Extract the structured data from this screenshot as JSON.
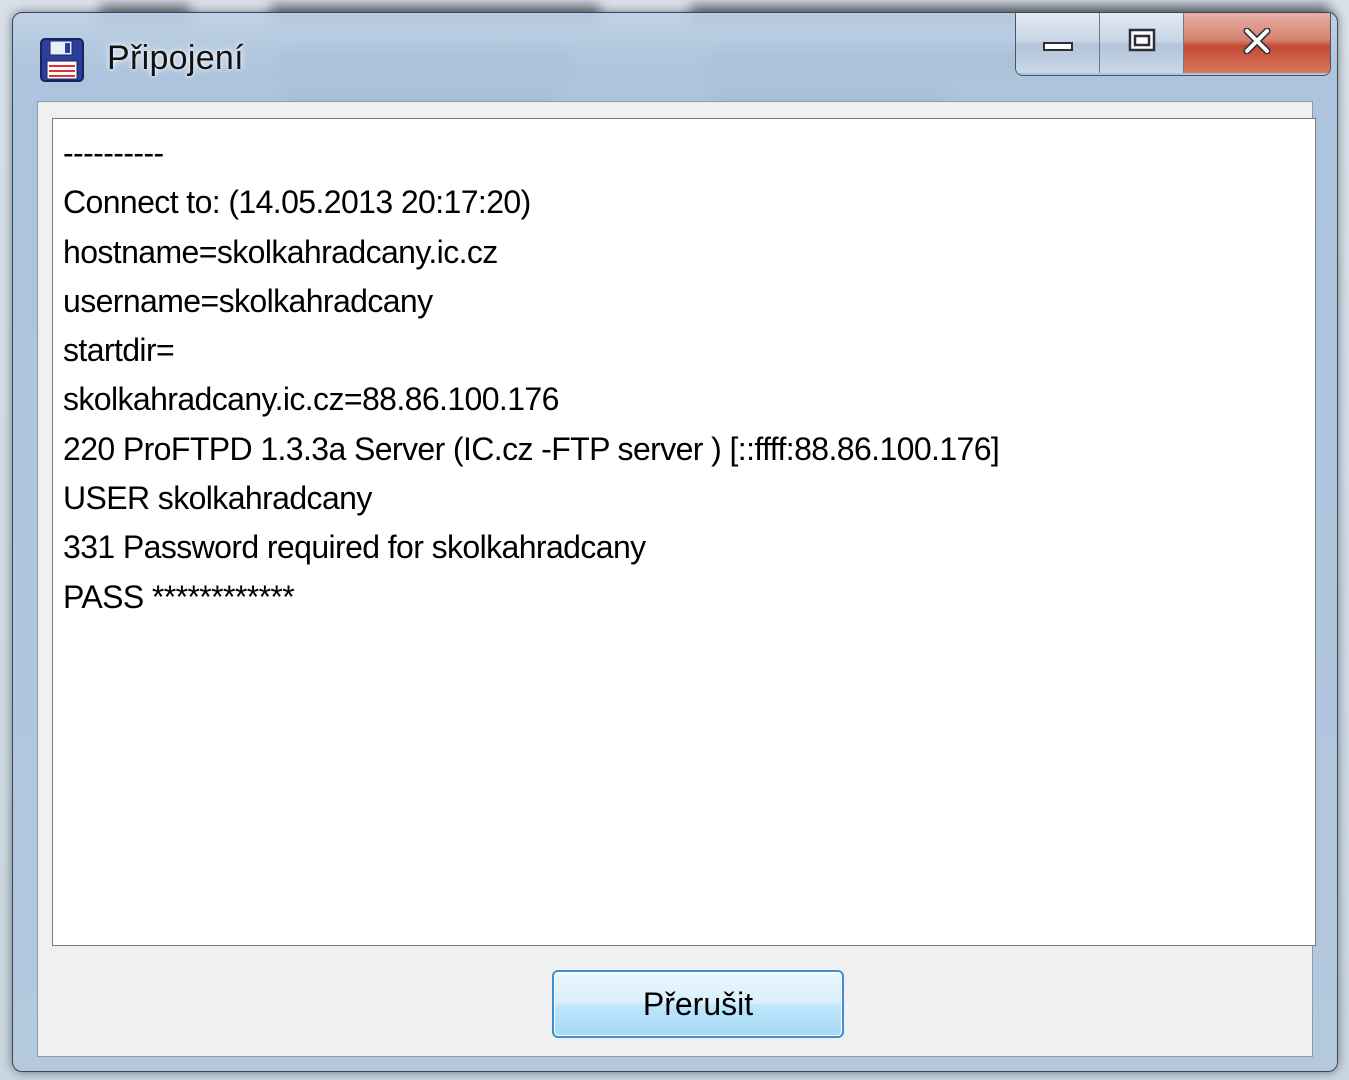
{
  "window": {
    "title": "Připojení",
    "icon": "floppy-disk-icon",
    "caption_buttons": {
      "minimize_glyph": "▭",
      "maximize_glyph": "▣",
      "close_glyph": "✕"
    }
  },
  "log": {
    "lines": [
      "----------",
      "Connect to: (14.05.2013 20:17:20)",
      "hostname=skolkahradcany.ic.cz",
      "username=skolkahradcany",
      "startdir=",
      "skolkahradcany.ic.cz=88.86.100.176",
      "220 ProFTPD 1.3.3a Server (IC.cz -FTP server ) [::ffff:88.86.100.176]",
      "USER skolkahradcany",
      "331 Password required for skolkahradcany",
      "PASS ************"
    ]
  },
  "buttons": {
    "abort_label": "Přerušit"
  },
  "colors": {
    "accent": "#3c8fd0",
    "close_button": "#c34a33"
  }
}
